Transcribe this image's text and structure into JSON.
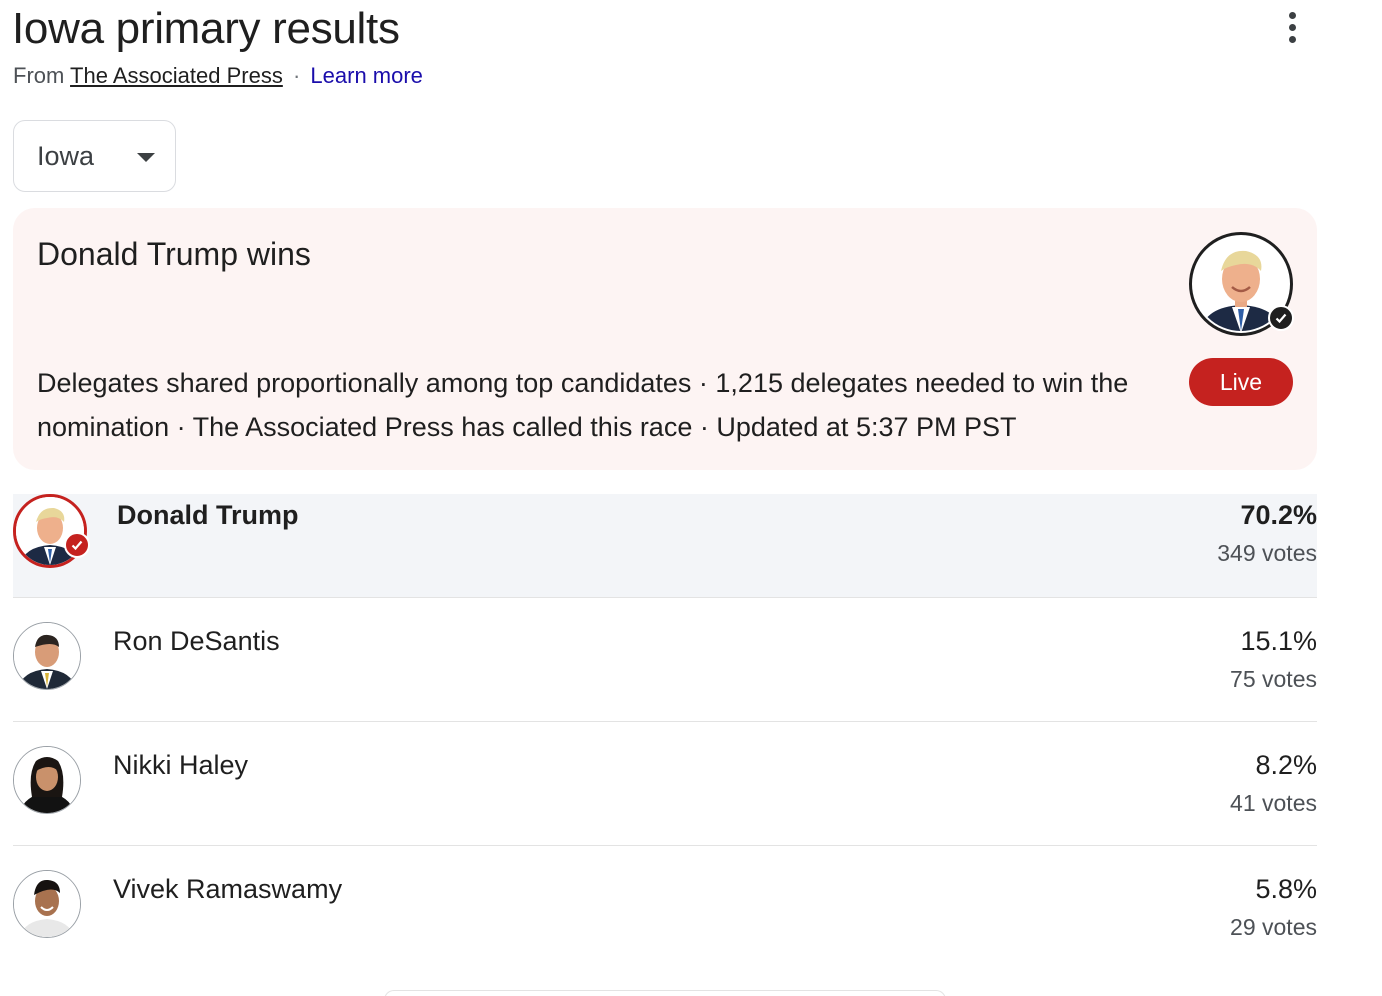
{
  "header": {
    "title": "Iowa primary results",
    "source_prefix": "From",
    "source_name": "The Associated Press",
    "separator": "·",
    "learn_more": "Learn more"
  },
  "menu_icon": "more-vert-icon",
  "state_select": {
    "selected": "Iowa"
  },
  "banner": {
    "headline": "Donald Trump wins",
    "description": "Delegates shared proportionally among top candidates · 1,215 delegates needed to win the nomination · The Associated Press has called this race · Updated at 5:37 PM PST",
    "live_label": "Live"
  },
  "candidates": [
    {
      "name": "Donald Trump",
      "percent": "70.2%",
      "votes": "349 votes",
      "winner": true
    },
    {
      "name": "Ron DeSantis",
      "percent": "15.1%",
      "votes": "75 votes",
      "winner": false
    },
    {
      "name": "Nikki Haley",
      "percent": "8.2%",
      "votes": "41 votes",
      "winner": false
    },
    {
      "name": "Vivek Ramaswamy",
      "percent": "5.8%",
      "votes": "29 votes",
      "winner": false
    }
  ],
  "colors": {
    "accent_red": "#c5221f",
    "link_blue": "#1a0dab",
    "banner_bg": "#fdf4f3",
    "winner_row_bg": "#f3f5f8"
  }
}
